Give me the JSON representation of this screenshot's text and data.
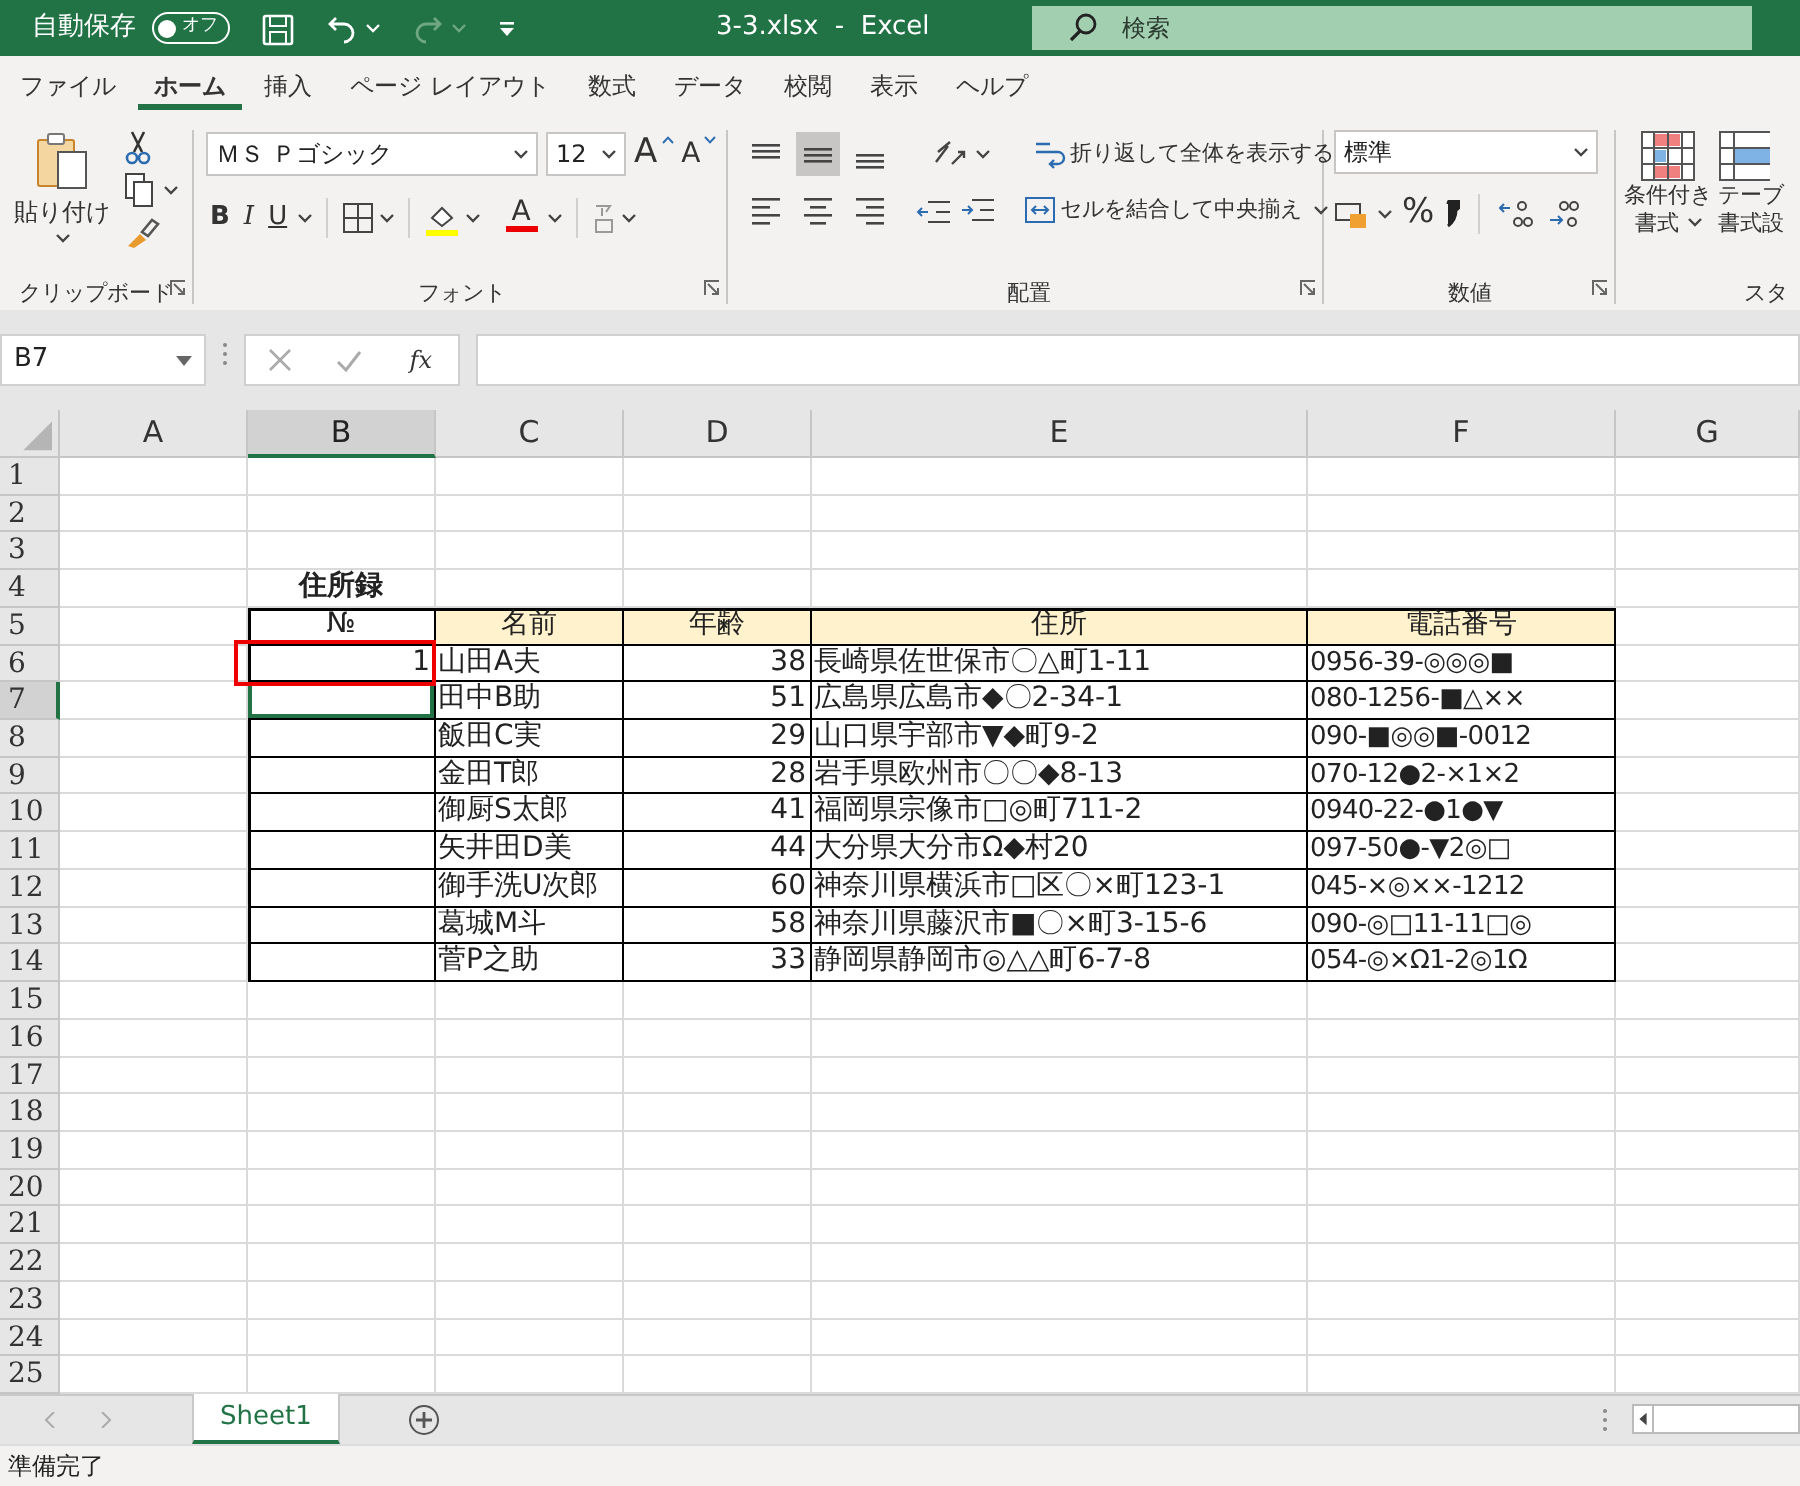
{
  "title_bar": {
    "autosave_label": "自動保存",
    "autosave": {
      "label": "オフ",
      "on": false
    },
    "undo": {
      "disabled": false
    },
    "redo": {
      "disabled": true
    },
    "document_title": "3-3.xlsx  -  Excel",
    "search": {
      "placeholder": "検索"
    }
  },
  "menu_tabs": [
    {
      "label": "ファイル",
      "selected": false
    },
    {
      "label": "ホーム",
      "selected": true
    },
    {
      "label": "挿入",
      "selected": false
    },
    {
      "label": "ページ レイアウト",
      "selected": false
    },
    {
      "label": "数式",
      "selected": false
    },
    {
      "label": "データ",
      "selected": false
    },
    {
      "label": "校閲",
      "selected": false
    },
    {
      "label": "表示",
      "selected": false
    },
    {
      "label": "ヘルプ",
      "selected": false
    }
  ],
  "ribbon": {
    "clipboard": {
      "paste": "貼り付け",
      "group_label": "クリップボード"
    },
    "font": {
      "font_name": "ＭＳ Ｐゴシック",
      "font_size": "12",
      "grow": "A",
      "shrink": "A",
      "bold": "B",
      "italic": "I",
      "underline": "U",
      "font_color": "A",
      "group_label": "フォント"
    },
    "alignment": {
      "vertical": [
        {
          "selected": false
        },
        {
          "selected": true
        },
        {
          "selected": false
        }
      ],
      "wrap_text": "折り返して全体を表示する",
      "merge": "セルを結合して中央揃え",
      "group_label": "配置"
    },
    "number": {
      "format": "標準",
      "percent": "%",
      "group_label": "数値"
    },
    "styles": {
      "conditional": [
        "条件付き",
        "書式"
      ],
      "table_format": [
        "テーブ",
        "書式設"
      ],
      "group_label": "スタ"
    }
  },
  "formula_bar": {
    "name_box": "B7",
    "function_label": "fx"
  },
  "sheet": {
    "columns": [
      {
        "label": "A",
        "selected": false
      },
      {
        "label": "B",
        "selected": true
      },
      {
        "label": "C",
        "selected": false
      },
      {
        "label": "D",
        "selected": false
      },
      {
        "label": "E",
        "selected": false
      },
      {
        "label": "F",
        "selected": false
      },
      {
        "label": "G",
        "selected": false
      }
    ],
    "rows": [
      {
        "label": "1",
        "selected": false
      },
      {
        "label": "2",
        "selected": false
      },
      {
        "label": "3",
        "selected": false
      },
      {
        "label": "4",
        "selected": false
      },
      {
        "label": "5",
        "selected": false
      },
      {
        "label": "6",
        "selected": false
      },
      {
        "label": "7",
        "selected": true
      },
      {
        "label": "8",
        "selected": false
      },
      {
        "label": "9",
        "selected": false
      },
      {
        "label": "10",
        "selected": false
      },
      {
        "label": "11",
        "selected": false
      },
      {
        "label": "12",
        "selected": false
      },
      {
        "label": "13",
        "selected": false
      },
      {
        "label": "14",
        "selected": false
      },
      {
        "label": "15",
        "selected": false
      },
      {
        "label": "16",
        "selected": false
      },
      {
        "label": "17",
        "selected": false
      },
      {
        "label": "18",
        "selected": false
      },
      {
        "label": "19",
        "selected": false
      },
      {
        "label": "20",
        "selected": false
      },
      {
        "label": "21",
        "selected": false
      },
      {
        "label": "22",
        "selected": false
      },
      {
        "label": "23",
        "selected": false
      },
      {
        "label": "24",
        "selected": false
      },
      {
        "label": "25",
        "selected": false
      }
    ],
    "title": "住所録",
    "header": [
      "№",
      "名前",
      "年齢",
      "住所",
      "電話番号"
    ],
    "records": [
      {
        "no": "1",
        "name": "山田A夫",
        "age": "38",
        "address": "長崎県佐世保市〇△町1-11",
        "phone": "0956-39-◎◎◎■",
        "highlighted": true
      },
      {
        "name": "田中B助",
        "age": "51",
        "address": "広島県広島市◆〇2-34-1",
        "phone": "080-1256-■△××",
        "highlighted": false
      },
      {
        "name": "飯田C実",
        "age": "29",
        "address": "山口県宇部市▼◆町9-2",
        "phone": "090-■◎◎■-0012",
        "highlighted": false
      },
      {
        "name": "金田T郎",
        "age": "28",
        "address": "岩手県欧州市〇〇◆8-13",
        "phone": "070-12●2-×1×2",
        "highlighted": false
      },
      {
        "name": "御厨S太郎",
        "age": "41",
        "address": "福岡県宗像市□◎町711-2",
        "phone": "0940-22-●1●▼",
        "highlighted": false
      },
      {
        "name": "矢井田D美",
        "age": "44",
        "address": "大分県大分市Ω◆村20",
        "phone": "097-50●-▼2◎□",
        "highlighted": false
      },
      {
        "name": "御手洗U次郎",
        "age": "60",
        "address": "神奈川県横浜市□区〇×町123-1",
        "phone": "045-×◎××-1212",
        "highlighted": false
      },
      {
        "name": "葛城M斗",
        "age": "58",
        "address": "神奈川県藤沢市■〇×町3-15-6",
        "phone": "090-◎□11-11□◎",
        "highlighted": false
      },
      {
        "name": "菅P之助",
        "age": "33",
        "address": "静岡県静岡市◎△△町6-7-8",
        "phone": "054-◎×Ω1-2◎1Ω",
        "highlighted": false
      }
    ]
  },
  "sheet_tabs": [
    {
      "label": "Sheet1",
      "selected": true
    }
  ],
  "status_bar": "準備完了"
}
